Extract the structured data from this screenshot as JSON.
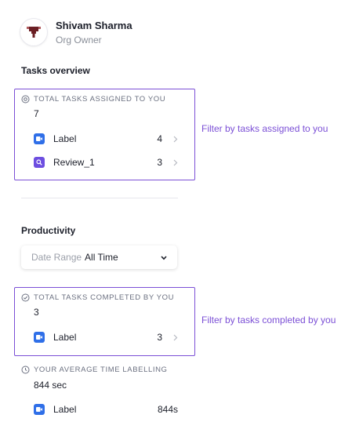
{
  "user": {
    "name": "Shivam Sharma",
    "role": "Org Owner"
  },
  "tasks_overview": {
    "title": "Tasks overview",
    "heading": "TOTAL TASKS ASSIGNED TO YOU",
    "total": "7",
    "items": [
      {
        "label": "Label",
        "count": "4",
        "icon": "label-tag-icon",
        "color": "#2f6fe8"
      },
      {
        "label": "Review_1",
        "count": "3",
        "icon": "review-search-icon",
        "color": "#6d4ee0"
      }
    ],
    "note": "Filter by tasks assigned to you"
  },
  "productivity": {
    "title": "Productivity",
    "date_range": {
      "label": "Date Range",
      "value": "All Time"
    },
    "completed": {
      "heading": "TOTAL TASKS COMPLETED BY YOU",
      "total": "3",
      "items": [
        {
          "label": "Label",
          "count": "3",
          "icon": "label-tag-icon",
          "color": "#2f6fe8"
        }
      ],
      "note": "Filter by tasks completed by you"
    },
    "avg_time": {
      "heading": "YOUR AVERAGE TIME LABELLING",
      "total": "844 sec",
      "items": [
        {
          "label": "Label",
          "value": "844s",
          "icon": "label-tag-icon",
          "color": "#2f6fe8"
        }
      ]
    }
  },
  "colors": {
    "accent": "#7b4fd6",
    "label_tag": "#2f6fe8",
    "review_tag": "#6d4ee0"
  }
}
